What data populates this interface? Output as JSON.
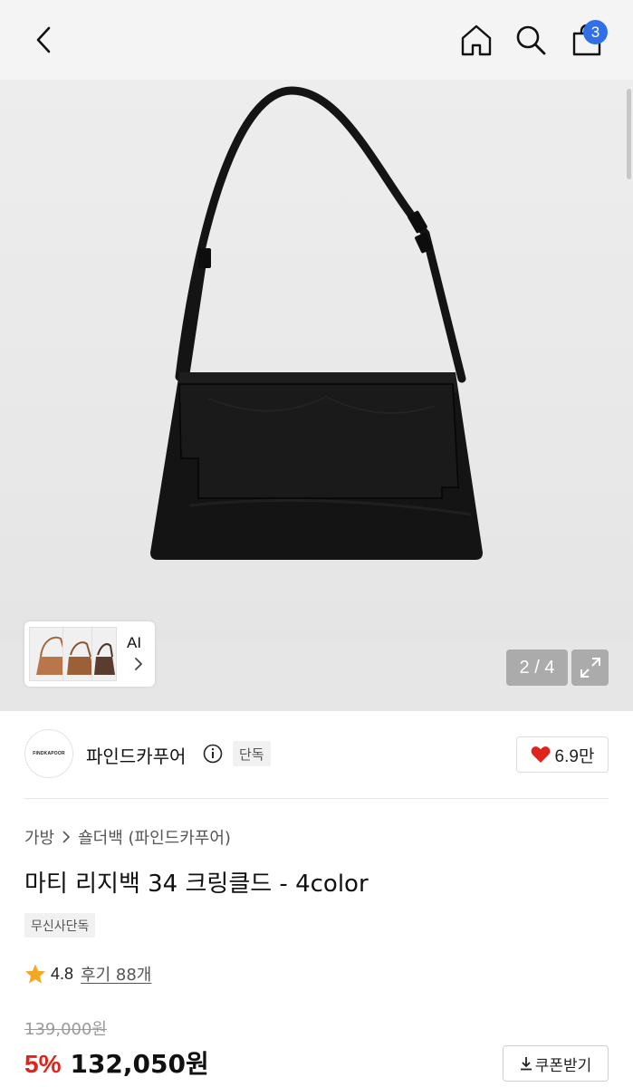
{
  "header": {
    "cart_count": "3",
    "icons": [
      "chevron-left-icon",
      "home-icon",
      "search-icon",
      "shopping-bag-icon"
    ]
  },
  "gallery": {
    "ai_label": "AI",
    "counter": "2 / 4",
    "product_color": "#121212"
  },
  "brand": {
    "logo_text": "FINDKAPOOR",
    "name": "파인드카푸어",
    "exclusive_tag": "단독",
    "likes": "6.9만",
    "heart_color": "#e0241b"
  },
  "product": {
    "breadcrumb": [
      "가방",
      "숄더백 (파인드카푸어)"
    ],
    "title": "마티 리지백 34 크링클드 - 4color",
    "store_tag": "무신사단독",
    "rating": "4.8",
    "review_label": "후기 88개",
    "star_color": "#f5a623"
  },
  "price": {
    "original": "139,000원",
    "discount": "5%",
    "sale": "132,050원",
    "coupon_label": "쿠폰받기",
    "discount_color": "#e0241b"
  }
}
